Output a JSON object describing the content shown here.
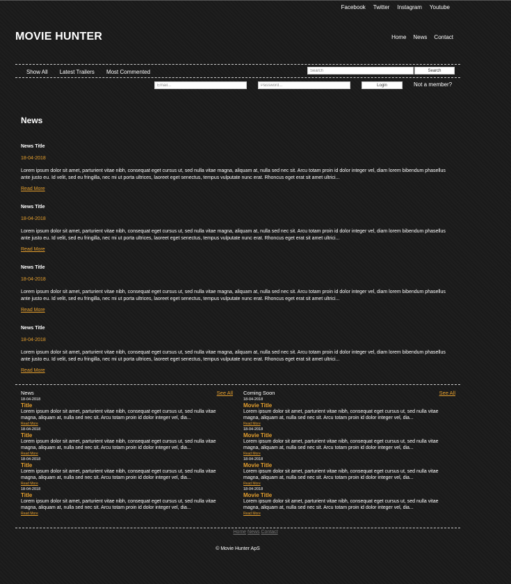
{
  "social": [
    "Facebook",
    "Twitter",
    "Instagram",
    "Youtube"
  ],
  "site_title": "MOVIE HUNTER",
  "main_nav": [
    "Home",
    "News",
    "Contact"
  ],
  "sub_nav": [
    "Show All",
    "Latest Trailers",
    "Most Commented"
  ],
  "search": {
    "placeholder": "Search",
    "button": "Search"
  },
  "login": {
    "email_placeholder": "Email...",
    "password_placeholder": "Password...",
    "button": "Login",
    "not_member": "Not a member?"
  },
  "news_heading": "News",
  "articles": [
    {
      "title": "News Title",
      "date": "18-04-2018",
      "body": "Lorem ipsum dolor sit amet, parturient vitae nibh, consequat eget cursus ut, sed nulla vitae magna, aliquam at, nulla sed nec sit. Arcu totam proin id dolor integer vel, diam lorem bibendum phasellus ante justo eu. Id velit, sed eu fringilla, nec mi ut porta ultrices, laoreet eget senectus, tempus vulputate nunc erat. Rhoncus eget erat sit amet ultrici...",
      "more": "Read More"
    },
    {
      "title": "News Title",
      "date": "18-04-2018",
      "body": "Lorem ipsum dolor sit amet, parturient vitae nibh, consequat eget cursus ut, sed nulla vitae magna, aliquam at, nulla sed nec sit. Arcu totam proin id dolor integer vel, diam lorem bibendum phasellus ante justo eu. Id velit, sed eu fringilla, nec mi ut porta ultrices, laoreet eget senectus, tempus vulputate nunc erat. Rhoncus eget erat sit amet ultrici...",
      "more": "Read More"
    },
    {
      "title": "News Title",
      "date": "18-04-2018",
      "body": "Lorem ipsum dolor sit amet, parturient vitae nibh, consequat eget cursus ut, sed nulla vitae magna, aliquam at, nulla sed nec sit. Arcu totam proin id dolor integer vel, diam lorem bibendum phasellus ante justo eu. Id velit, sed eu fringilla, nec mi ut porta ultrices, laoreet eget senectus, tempus vulputate nunc erat. Rhoncus eget erat sit amet ultrici...",
      "more": "Read More"
    },
    {
      "title": "News Title",
      "date": "18-04-2018",
      "body": "Lorem ipsum dolor sit amet, parturient vitae nibh, consequat eget cursus ut, sed nulla vitae magna, aliquam at, nulla sed nec sit. Arcu totam proin id dolor integer vel, diam lorem bibendum phasellus ante justo eu. Id velit, sed eu fringilla, nec mi ut porta ultrices, laoreet eget senectus, tempus vulputate nunc erat. Rhoncus eget erat sit amet ultrici...",
      "more": "Read More"
    }
  ],
  "news_column": {
    "heading": "News",
    "see_all": "See All",
    "items": [
      {
        "date": "18-04-2018",
        "title": "Title",
        "body": "Lorem ipsum dolor sit amet, parturient vitae nibh, consequat eget cursus ut, sed nulla vitae magna, aliquam at, nulla sed nec sit. Arcu totam proin id dolor integer vel, dia...",
        "more": "Read More"
      },
      {
        "date": "18-04-2018",
        "title": "Title",
        "body": "Lorem ipsum dolor sit amet, parturient vitae nibh, consequat eget cursus ut, sed nulla vitae magna, aliquam at, nulla sed nec sit. Arcu totam proin id dolor integer vel, dia...",
        "more": "Read More"
      },
      {
        "date": "18-04-2018",
        "title": "Title",
        "body": "Lorem ipsum dolor sit amet, parturient vitae nibh, consequat eget cursus ut, sed nulla vitae magna, aliquam at, nulla sed nec sit. Arcu totam proin id dolor integer vel, dia...",
        "more": "Read More"
      },
      {
        "date": "18-04-2018",
        "title": "Title",
        "body": "Lorem ipsum dolor sit amet, parturient vitae nibh, consequat eget cursus ut, sed nulla vitae magna, aliquam at, nulla sed nec sit. Arcu totam proin id dolor integer vel, dia...",
        "more": "Read More"
      }
    ]
  },
  "coming_column": {
    "heading": "Coming Soon",
    "see_all": "See All",
    "items": [
      {
        "date": "18-04-2018",
        "title": "Movie Title",
        "body": "Lorem ipsum dolor sit amet, parturient vitae nibh, consequat eget cursus ut, sed nulla vitae magna, aliquam at, nulla sed nec sit. Arcu totam proin id dolor integer vel, dia...",
        "more": "Read More"
      },
      {
        "date": "18-04-2018",
        "title": "Movie Title",
        "body": "Lorem ipsum dolor sit amet, parturient vitae nibh, consequat eget cursus ut, sed nulla vitae magna, aliquam at, nulla sed nec sit. Arcu totam proin id dolor integer vel, dia...",
        "more": "Read More"
      },
      {
        "date": "18-04-2018",
        "title": "Movie Title",
        "body": "Lorem ipsum dolor sit amet, parturient vitae nibh, consequat eget cursus ut, sed nulla vitae magna, aliquam at, nulla sed nec sit. Arcu totam proin id dolor integer vel, dia...",
        "more": "Read More"
      },
      {
        "date": "18-04-2018",
        "title": "Movie Title",
        "body": "Lorem ipsum dolor sit amet, parturient vitae nibh, consequat eget cursus ut, sed nulla vitae magna, aliquam at, nulla sed nec sit. Arcu totam proin id dolor integer vel, dia...",
        "more": "Read More"
      }
    ]
  },
  "footer_nav": [
    "Home",
    "News",
    "Contact"
  ],
  "copyright": "© Movie Hunter ApS",
  "colors": {
    "accent": "#e8a12e",
    "background": "#1b1b1b",
    "text": "#ffffff"
  }
}
